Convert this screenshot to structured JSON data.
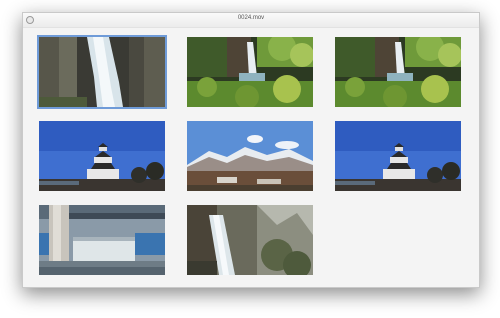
{
  "window": {
    "title": "0024.mov",
    "close_icon": "close-icon"
  },
  "frames": [
    {
      "label": "waterfall-closeup",
      "selected": true
    },
    {
      "label": "waterfall-forest"
    },
    {
      "label": "waterfall-forest"
    },
    {
      "label": "castle-blue-sky"
    },
    {
      "label": "snowy-mountains"
    },
    {
      "label": "castle-blue-sky"
    },
    {
      "label": "dam-spillway"
    },
    {
      "label": "waterfall-cliff"
    }
  ],
  "colors": {
    "selection": "#6f9bd8",
    "window_bg": "#f4f4f4"
  }
}
